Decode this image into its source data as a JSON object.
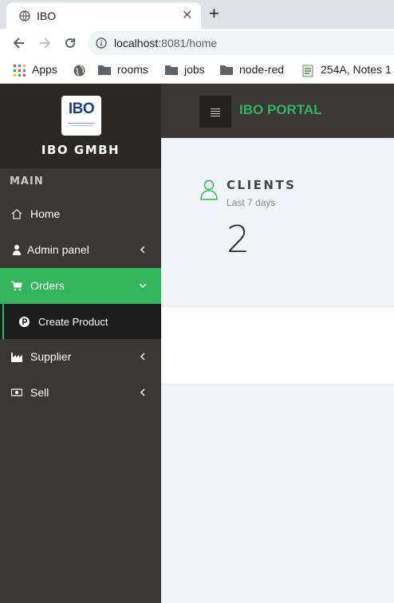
{
  "browser": {
    "tab_title": "IBO",
    "url_host": "localhost",
    "url_rest": ":8081/home",
    "bookmarks": [
      {
        "label": "Apps",
        "icon": "apps-grid-icon"
      },
      {
        "label": "",
        "icon": "globe-icon"
      },
      {
        "label": "rooms",
        "icon": "folder-icon"
      },
      {
        "label": "jobs",
        "icon": "folder-icon"
      },
      {
        "label": "node-red",
        "icon": "folder-icon"
      },
      {
        "label": "254A, Notes 1",
        "icon": "document-icon"
      }
    ]
  },
  "sidebar": {
    "brand_logo_text": "IBO",
    "brand_name": "IBO GMBH",
    "section_label": "MAIN",
    "items": [
      {
        "label": "Home",
        "icon": "home-icon"
      },
      {
        "label": "Admin panel",
        "icon": "user-icon"
      },
      {
        "label": "Orders",
        "icon": "cart-icon"
      },
      {
        "label": "Supplier",
        "icon": "factory-icon"
      },
      {
        "label": "Sell",
        "icon": "money-icon"
      }
    ],
    "submenu": {
      "label": "Create Product",
      "icon": "product-icon"
    }
  },
  "topbar": {
    "title": "IBO PORTAL"
  },
  "stats": {
    "title": "CLIENTS",
    "subtitle": "Last 7 days",
    "value": "2"
  },
  "colors": {
    "accent": "#34b45d",
    "sidebar": "#3a3836",
    "brand_bg": "#292827",
    "submenu_bg": "#1c1c1c"
  }
}
